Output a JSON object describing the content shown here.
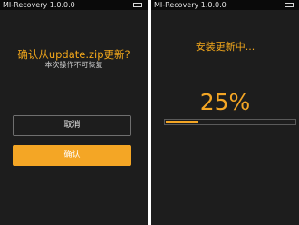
{
  "colors": {
    "background": "#1d1d1d",
    "accent": "#f4a625",
    "status_bar": "#0a0a0a"
  },
  "confirm_screen": {
    "status_bar": {
      "title": "MI-Recovery 1.0.0.0",
      "battery_icon": "battery-icon"
    },
    "question": "确认从update.zip更新?",
    "subtext": "本次操作不可恢复",
    "cancel_label": "取消",
    "confirm_label": "确认"
  },
  "progress_screen": {
    "status_bar": {
      "title": "MI-Recovery 1.0.0.0",
      "battery_icon": "battery-icon"
    },
    "status_text": "安装更新中...",
    "percent_label": "25%",
    "progress_fraction": 0.25
  }
}
